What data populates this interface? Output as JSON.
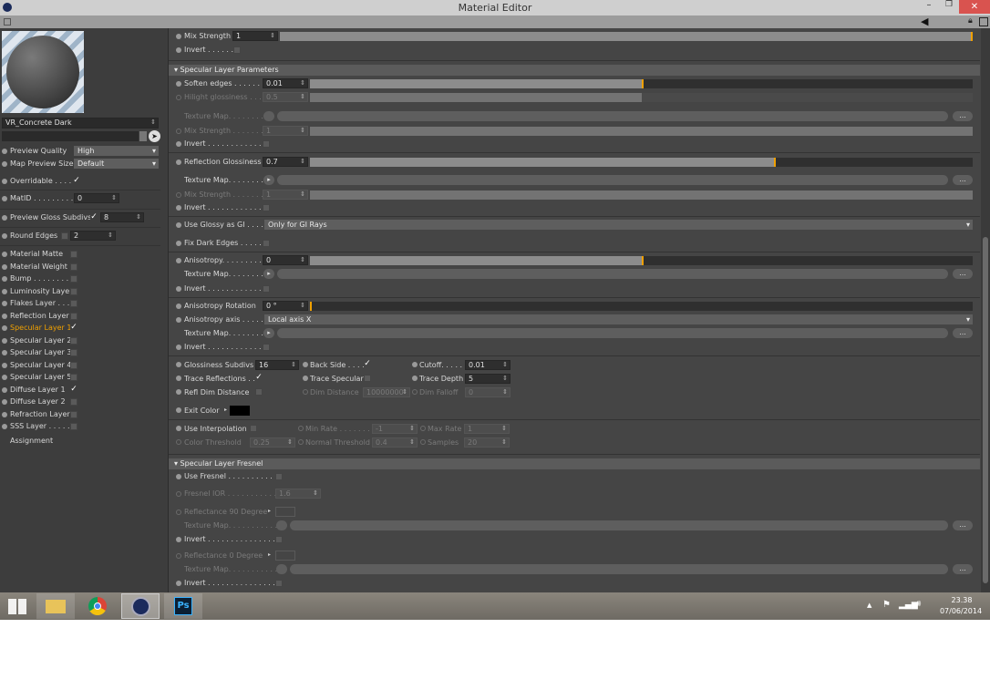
{
  "window": {
    "title": "Material Editor"
  },
  "left": {
    "material_name": "VR_Concrete Dark",
    "preview_quality": {
      "label": "Preview Quality",
      "value": "High"
    },
    "map_preview_size": {
      "label": "Map Preview Size",
      "value": "Default"
    },
    "overridable": {
      "label": "Overridable . . . .",
      "checked": true
    },
    "matid": {
      "label": "MatID . . . . . . . . .",
      "value": "0"
    },
    "preview_gloss": {
      "label": "Preview Gloss Subdivs",
      "checked": true,
      "value": "8"
    },
    "round_edges": {
      "label": "Round Edges",
      "checked": false,
      "value": "2"
    },
    "layers": [
      {
        "label": "Material Matte",
        "checked": false
      },
      {
        "label": "Material Weight",
        "checked": false
      },
      {
        "label": "Bump . . . . . . . . .",
        "checked": false
      },
      {
        "label": "Luminosity Layer",
        "checked": false
      },
      {
        "label": "Flakes Layer . . . .",
        "checked": false
      },
      {
        "label": "Reflection Layer",
        "checked": false
      },
      {
        "label": "Specular Layer 1",
        "checked": true,
        "active": true
      },
      {
        "label": "Specular Layer 2",
        "checked": false
      },
      {
        "label": "Specular Layer 3",
        "checked": false
      },
      {
        "label": "Specular Layer 4",
        "checked": false
      },
      {
        "label": "Specular Layer 5",
        "checked": false
      },
      {
        "label": "Diffuse Layer 1",
        "checked": true
      },
      {
        "label": "Diffuse Layer 2",
        "checked": false
      },
      {
        "label": "Refraction Layer",
        "checked": false
      },
      {
        "label": "SSS Layer . . . . . .",
        "checked": false
      }
    ],
    "assignment": "Assignment",
    "active_color": "#f0a000"
  },
  "rows": [
    {
      "label": "Mix Strength",
      "type": "slider",
      "value": "1",
      "fraction": 1.0
    },
    {
      "label": "Invert . . . . . .",
      "type": "check",
      "checked": false
    },
    {
      "label": "Specular Layer Parameters",
      "type": "header"
    },
    {
      "label": "Soften edges . . . . . . .",
      "type": "slider",
      "value": "0.01",
      "fraction": 0.5
    },
    {
      "label": "Hilight glossiness . . .",
      "type": "slider",
      "value": "0.5",
      "fraction": 0.5,
      "disabled": true
    },
    {
      "label": "Texture Map. . . . . . . .",
      "type": "texture",
      "disabled": true,
      "nobullet": true,
      "dots": "..."
    },
    {
      "label": "Mix Strength . . . . . . .",
      "type": "slider",
      "value": "1",
      "fraction": 1.0,
      "disabled": true
    },
    {
      "label": "Invert . . . . . . . . . . . . .",
      "type": "check",
      "checked": false
    },
    {
      "label": "Reflection Glossiness",
      "type": "slider",
      "value": "0.7",
      "fraction": 0.7
    },
    {
      "label": "Texture Map. . . . . . . .",
      "type": "texture",
      "nobullet": true,
      "arrow": true,
      "dots": "..."
    },
    {
      "label": "Mix Strength . . . . . . .",
      "type": "slider",
      "value": "1",
      "fraction": 1.0,
      "disabled": true
    },
    {
      "label": "Invert . . . . . . . . . . . . .",
      "type": "check",
      "checked": false
    },
    {
      "label": "Use Glossy as GI . . . .",
      "type": "dropdown",
      "value": "Only for GI Rays"
    },
    {
      "label": "Fix Dark Edges . . . . . .",
      "type": "check",
      "checked": false
    },
    {
      "label": "Anisotropy. . . . . . . . .",
      "type": "slider",
      "value": "0",
      "fraction": 0.5
    },
    {
      "label": "Texture Map. . . . . . . .",
      "type": "texture",
      "nobullet": true,
      "arrow": true,
      "dots": "..."
    },
    {
      "label": "Invert . . . . . . . . . . . . .",
      "type": "check",
      "checked": false
    },
    {
      "label": "Anisotropy Rotation",
      "type": "slider",
      "value": "0 °",
      "fraction": 0.0,
      "nofill": true
    },
    {
      "label": "Anisotropy axis . . . . .",
      "type": "dropdown",
      "value": "Local axis X"
    },
    {
      "label": "Texture Map. . . . . . . .",
      "type": "texture",
      "nobullet": true,
      "arrow": true,
      "dots": "..."
    },
    {
      "label": "Invert . . . . . . . . . . . . .",
      "type": "check",
      "checked": false
    },
    {
      "label": "Specular Layer Fresnel",
      "type": "header"
    },
    {
      "label": "Use Fresnel . . . . . . . . . . .",
      "type": "check",
      "checked": false
    },
    {
      "label": "Fresnel IOR . . . . . . . . . . .",
      "type": "field",
      "value": "1.6",
      "disabled": true
    },
    {
      "label": "Reflectance 90 Degree",
      "type": "color",
      "disabled": true,
      "color": "#454545"
    },
    {
      "label": "Texture Map. . . . . . . . . . .",
      "type": "texture",
      "disabled": true,
      "nobullet": true,
      "dots": "..."
    },
    {
      "label": "Invert . . . . . . . . . . . . . . . .",
      "type": "check",
      "checked": false
    },
    {
      "label": "Reflectance  0 Degree",
      "type": "color",
      "disabled": true,
      "color": "#454545"
    },
    {
      "label": "Texture Map. . . . . . . . . . .",
      "type": "texture",
      "disabled": true,
      "nobullet": true,
      "dots": "..."
    },
    {
      "label": "Invert . . . . . . . . . . . . . . . .",
      "type": "check",
      "checked": false
    }
  ],
  "grid": {
    "glossiness_subdivs": {
      "label": "Glossiness Subdivs",
      "value": "16"
    },
    "back_side": {
      "label": "Back Side . . . .",
      "checked": true
    },
    "cutoff": {
      "label": "Cutoff. . . . .",
      "value": "0.01"
    },
    "trace_reflections": {
      "label": "Trace Reflections . .",
      "checked": true
    },
    "trace_specular": {
      "label": "Trace Specular",
      "checked": false
    },
    "trace_depth": {
      "label": "Trace Depth",
      "value": "5"
    },
    "refl_dim_distance": {
      "label": "Refl Dim Distance",
      "checked": false
    },
    "dim_distance": {
      "label": "Dim Distance",
      "value": "10000000"
    },
    "dim_falloff": {
      "label": "Dim Falloff",
      "value": "0"
    },
    "exit_color": {
      "label": "Exit Color",
      "color": "#000000"
    },
    "use_interpolation": {
      "label": "Use Interpolation",
      "checked": false
    },
    "min_rate": {
      "label": "Min Rate . . . . . . . .",
      "value": "-1"
    },
    "max_rate": {
      "label": "Max Rate",
      "value": "1"
    },
    "color_threshold": {
      "label": "Color Threshold",
      "value": "0.25"
    },
    "normal_threshold": {
      "label": "Normal Threshold",
      "value": "0.4"
    },
    "samples": {
      "label": "Samples",
      "value": "20"
    }
  },
  "taskbar": {
    "time": "23.38",
    "date": "07/06/2014",
    "apps": [
      "start",
      "file-explorer",
      "chrome",
      "cinema4d",
      "photoshop"
    ],
    "photoshop_label": "Ps"
  }
}
